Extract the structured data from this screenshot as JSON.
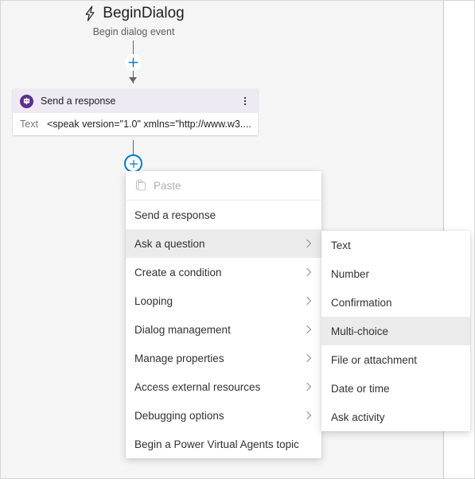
{
  "trigger": {
    "icon": "lightning-bolt-icon",
    "title": "BeginDialog",
    "subtitle": "Begin dialog event"
  },
  "card": {
    "icon": "bot-speech-bubble-icon",
    "title": "Send a response",
    "overflow_icon": "kebab-menu-icon",
    "field_label": "Text",
    "field_value": "<speak version=\"1.0\" xmlns=\"http://www.w3...."
  },
  "add_buttons": {
    "top": {
      "icon": "plus-icon",
      "color": "#0078d4"
    },
    "active": {
      "icon": "plus-icon",
      "color": "#0078d4",
      "border_color": "#0078d4"
    }
  },
  "menu": {
    "items": [
      {
        "label": "Paste",
        "icon": "clipboard-paste-icon",
        "disabled": true,
        "submenu": false,
        "highlight": false
      },
      {
        "label": "Send a response",
        "icon": null,
        "disabled": false,
        "submenu": false,
        "highlight": false
      },
      {
        "label": "Ask a question",
        "icon": null,
        "disabled": false,
        "submenu": true,
        "highlight": true
      },
      {
        "label": "Create a condition",
        "icon": null,
        "disabled": false,
        "submenu": true,
        "highlight": false
      },
      {
        "label": "Looping",
        "icon": null,
        "disabled": false,
        "submenu": true,
        "highlight": false
      },
      {
        "label": "Dialog management",
        "icon": null,
        "disabled": false,
        "submenu": true,
        "highlight": false
      },
      {
        "label": "Manage properties",
        "icon": null,
        "disabled": false,
        "submenu": true,
        "highlight": false
      },
      {
        "label": "Access external resources",
        "icon": null,
        "disabled": false,
        "submenu": true,
        "highlight": false
      },
      {
        "label": "Debugging options",
        "icon": null,
        "disabled": false,
        "submenu": true,
        "highlight": false
      },
      {
        "label": "Begin a Power Virtual Agents topic",
        "icon": null,
        "disabled": false,
        "submenu": false,
        "highlight": false
      }
    ]
  },
  "submenu": {
    "parent": "Ask a question",
    "items": [
      {
        "label": "Text",
        "highlight": false
      },
      {
        "label": "Number",
        "highlight": false
      },
      {
        "label": "Confirmation",
        "highlight": false
      },
      {
        "label": "Multi-choice",
        "highlight": true
      },
      {
        "label": "File or attachment",
        "highlight": false
      },
      {
        "label": "Date or time",
        "highlight": false
      },
      {
        "label": "Ask activity",
        "highlight": false
      }
    ]
  },
  "colors": {
    "canvas": "#f5f5f5",
    "card_header": "#eeeaf4",
    "accent": "#0078d4",
    "brand_purple": "#5c2e91",
    "highlight": "#ebebeb"
  }
}
